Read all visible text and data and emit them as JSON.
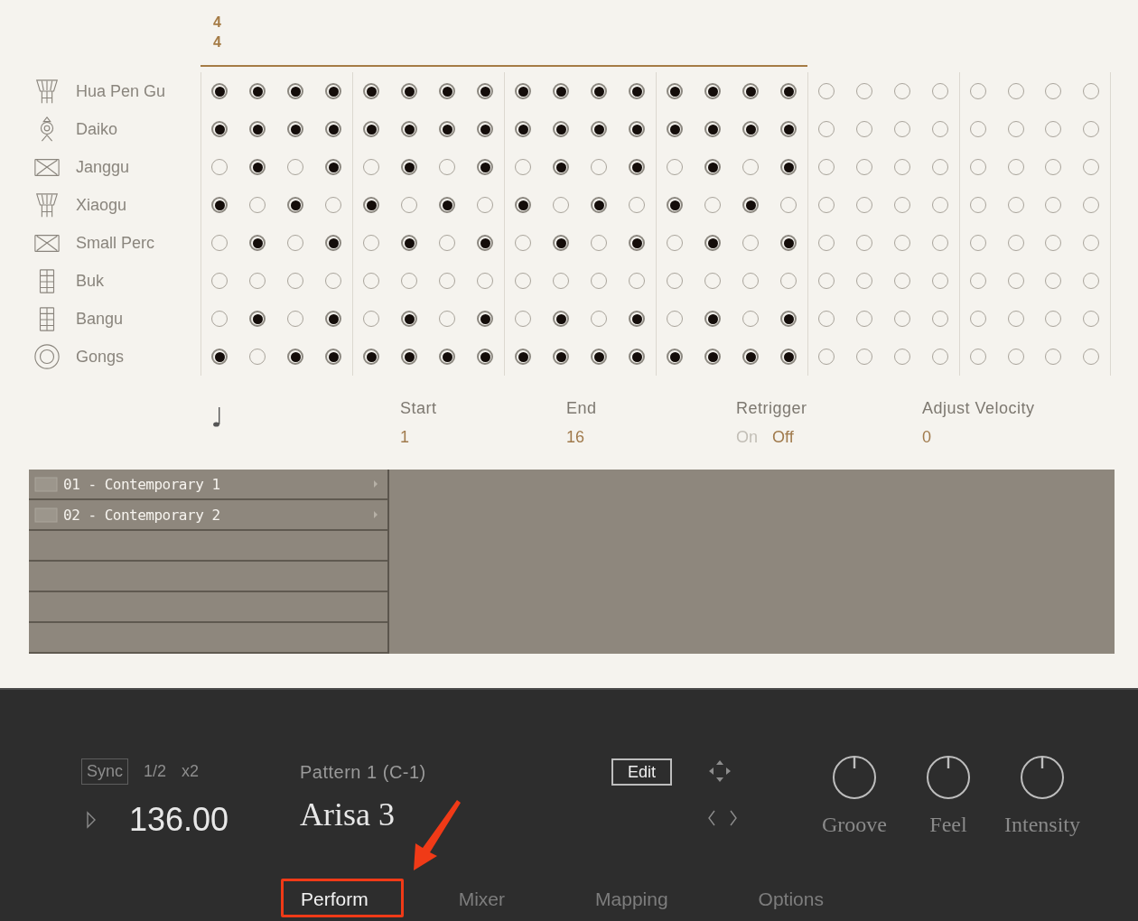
{
  "time_signature": [
    "4",
    "4"
  ],
  "tracks": [
    {
      "name": "Hua Pen Gu",
      "steps": [
        true,
        true,
        true,
        true,
        true,
        true,
        true,
        true,
        true,
        true,
        true,
        true,
        true,
        true,
        true,
        true,
        false,
        false,
        false,
        false,
        false,
        false,
        false,
        false
      ]
    },
    {
      "name": "Daiko",
      "steps": [
        true,
        true,
        true,
        true,
        true,
        true,
        true,
        true,
        true,
        true,
        true,
        true,
        true,
        true,
        true,
        true,
        false,
        false,
        false,
        false,
        false,
        false,
        false,
        false
      ]
    },
    {
      "name": "Janggu",
      "steps": [
        false,
        true,
        false,
        true,
        false,
        true,
        false,
        true,
        false,
        true,
        false,
        true,
        false,
        true,
        false,
        true,
        false,
        false,
        false,
        false,
        false,
        false,
        false,
        false
      ]
    },
    {
      "name": "Xiaogu",
      "steps": [
        true,
        false,
        true,
        false,
        true,
        false,
        true,
        false,
        true,
        false,
        true,
        false,
        true,
        false,
        true,
        false,
        false,
        false,
        false,
        false,
        false,
        false,
        false,
        false
      ]
    },
    {
      "name": "Small Perc",
      "steps": [
        false,
        true,
        false,
        true,
        false,
        true,
        false,
        true,
        false,
        true,
        false,
        true,
        false,
        true,
        false,
        true,
        false,
        false,
        false,
        false,
        false,
        false,
        false,
        false
      ]
    },
    {
      "name": "Buk",
      "steps": [
        false,
        false,
        false,
        false,
        false,
        false,
        false,
        false,
        false,
        false,
        false,
        false,
        false,
        false,
        false,
        false,
        false,
        false,
        false,
        false,
        false,
        false,
        false,
        false
      ]
    },
    {
      "name": "Bangu",
      "steps": [
        false,
        true,
        false,
        true,
        false,
        true,
        false,
        true,
        false,
        true,
        false,
        true,
        false,
        true,
        false,
        true,
        false,
        false,
        false,
        false,
        false,
        false,
        false,
        false
      ]
    },
    {
      "name": "Gongs",
      "steps": [
        true,
        false,
        true,
        true,
        true,
        true,
        true,
        true,
        true,
        true,
        true,
        true,
        true,
        true,
        true,
        true,
        false,
        false,
        false,
        false,
        false,
        false,
        false,
        false
      ]
    }
  ],
  "params": [
    {
      "kind": "value",
      "label": "Start",
      "value": "1"
    },
    {
      "kind": "value",
      "label": "End",
      "value": "16"
    },
    {
      "kind": "toggle",
      "label": "Retrigger",
      "options": [
        {
          "label": "On",
          "selected": false
        },
        {
          "label": "Off",
          "selected": true
        }
      ]
    },
    {
      "kind": "value",
      "label": "Adjust Velocity",
      "value": "0"
    }
  ],
  "browser": {
    "folders": [
      {
        "name": "01 - Contemporary 1"
      },
      {
        "name": "02 - Contemporary 2"
      }
    ]
  },
  "transport": {
    "sync": "Sync",
    "division": "1/2",
    "multiplier": "x2",
    "tempo": "136.00"
  },
  "pattern": {
    "name": "Pattern 1 (C-1)",
    "title": "Arisa 3"
  },
  "edit_button": "Edit",
  "knobs": [
    {
      "label": "Groove"
    },
    {
      "label": "Feel"
    },
    {
      "label": "Intensity"
    }
  ],
  "tabs": [
    {
      "label": "Perform",
      "selected": true
    },
    {
      "label": "Mixer",
      "selected": false
    },
    {
      "label": "Mapping",
      "selected": false
    },
    {
      "label": "Options",
      "selected": false
    }
  ]
}
